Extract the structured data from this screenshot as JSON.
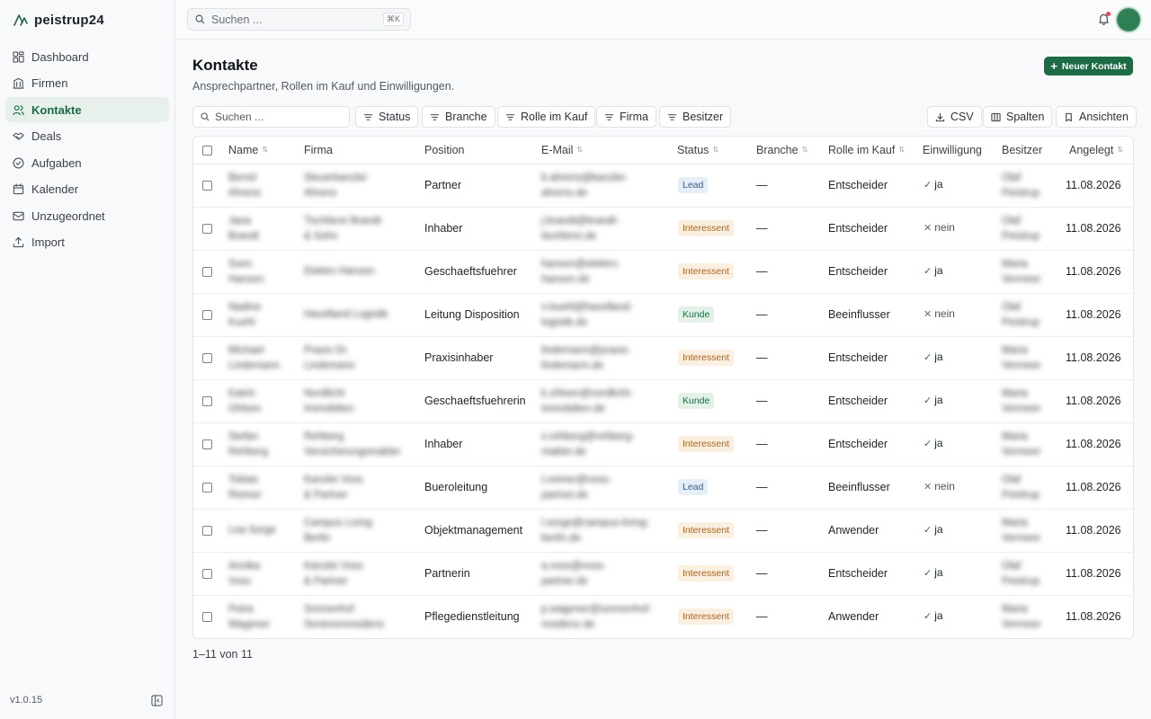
{
  "app": {
    "name": "peistrup24",
    "version": "v1.0.15"
  },
  "sidebar": {
    "items": [
      {
        "label": "Dashboard",
        "icon": "dashboard-icon",
        "active": false
      },
      {
        "label": "Firmen",
        "icon": "building-icon",
        "active": false
      },
      {
        "label": "Kontakte",
        "icon": "users-icon",
        "active": true
      },
      {
        "label": "Deals",
        "icon": "handshake-icon",
        "active": false
      },
      {
        "label": "Aufgaben",
        "icon": "check-circle-icon",
        "active": false
      },
      {
        "label": "Kalender",
        "icon": "calendar-icon",
        "active": false
      },
      {
        "label": "Unzugeordnet",
        "icon": "mail-icon",
        "active": false
      },
      {
        "label": "Import",
        "icon": "upload-icon",
        "active": false
      }
    ]
  },
  "topbar": {
    "search_placeholder": "Suchen ...",
    "shortcut": "⌘K"
  },
  "page": {
    "title": "Kontakte",
    "subtitle": "Ansprechpartner, Rollen im Kauf und Einwilligungen.",
    "new_button": "Neuer Kontakt"
  },
  "toolbar": {
    "search_placeholder": "Suchen ...",
    "filters": [
      "Status",
      "Branche",
      "Rolle im Kauf",
      "Firma",
      "Besitzer"
    ],
    "csv": "CSV",
    "columns": "Spalten",
    "views": "Ansichten"
  },
  "table": {
    "headers": {
      "name": "Name",
      "firma": "Firma",
      "position": "Position",
      "email": "E-Mail",
      "status": "Status",
      "branche": "Branche",
      "rolle": "Rolle im Kauf",
      "einwilligung": "Einwilligung",
      "besitzer": "Besitzer",
      "angelegt": "Angelegt"
    },
    "rows": [
      {
        "name": "Bernd Ahrens",
        "firma": "Steuerkanzlei Ahrens",
        "position": "Partner",
        "email": "b.ahrens@kanzlei-ahrens.de",
        "status": "Lead",
        "status_type": "lead",
        "branche": "—",
        "rolle": "Entscheider",
        "einwilligung": "ja",
        "consent": true,
        "besitzer": "Olaf Peistrup",
        "angelegt": "11.08.2026"
      },
      {
        "name": "Jana Brandt",
        "firma": "Tischlerei Brandt & Sohn",
        "position": "Inhaber",
        "email": "j.brandt@brandt-tischlerei.de",
        "status": "Interessent",
        "status_type": "interessent",
        "branche": "—",
        "rolle": "Entscheider",
        "einwilligung": "nein",
        "consent": false,
        "besitzer": "Olaf Peistrup",
        "angelegt": "11.08.2026"
      },
      {
        "name": "Sven Hansen",
        "firma": "Elektro Hansen",
        "position": "Geschaeftsfuehrer",
        "email": "hansen@elektro-hansen.de",
        "status": "Interessent",
        "status_type": "interessent",
        "branche": "—",
        "rolle": "Entscheider",
        "einwilligung": "ja",
        "consent": true,
        "besitzer": "Maria Vermeer",
        "angelegt": "11.08.2026"
      },
      {
        "name": "Nadine Kuehl",
        "firma": "Havelland Logistik",
        "position": "Leitung Disposition",
        "email": "n.kuehl@havelland-logistik.de",
        "status": "Kunde",
        "status_type": "kunde",
        "branche": "—",
        "rolle": "Beeinflusser",
        "einwilligung": "nein",
        "consent": false,
        "besitzer": "Olaf Peistrup",
        "angelegt": "11.08.2026"
      },
      {
        "name": "Michael Lindemann",
        "firma": "Praxis Dr. Lindemann",
        "position": "Praxisinhaber",
        "email": "lindemann@praxis-lindemann.de",
        "status": "Interessent",
        "status_type": "interessent",
        "branche": "—",
        "rolle": "Entscheider",
        "einwilligung": "ja",
        "consent": true,
        "besitzer": "Maria Vermeer",
        "angelegt": "11.08.2026"
      },
      {
        "name": "Katrin Ohlsen",
        "firma": "Nordlicht Immobilien",
        "position": "Geschaeftsfuehrerin",
        "email": "k.ohlsen@nordlicht-immobilien.de",
        "status": "Kunde",
        "status_type": "kunde",
        "branche": "—",
        "rolle": "Entscheider",
        "einwilligung": "ja",
        "consent": true,
        "besitzer": "Maria Vermeer",
        "angelegt": "11.08.2026"
      },
      {
        "name": "Stefan Rehberg",
        "firma": "Rehberg Versicherungsmakler",
        "position": "Inhaber",
        "email": "s.rehberg@rehberg-makler.de",
        "status": "Interessent",
        "status_type": "interessent",
        "branche": "—",
        "rolle": "Entscheider",
        "einwilligung": "ja",
        "consent": true,
        "besitzer": "Maria Vermeer",
        "angelegt": "11.08.2026"
      },
      {
        "name": "Tobias Reimer",
        "firma": "Kanzlei Voss & Partner",
        "position": "Bueroleitung",
        "email": "t.reimer@voss-partner.de",
        "status": "Lead",
        "status_type": "lead",
        "branche": "—",
        "rolle": "Beeinflusser",
        "einwilligung": "nein",
        "consent": false,
        "besitzer": "Olaf Peistrup",
        "angelegt": "11.08.2026"
      },
      {
        "name": "Lea Sorge",
        "firma": "Campus Living Berlin",
        "position": "Objektmanagement",
        "email": "l.sorge@campus-living-berlin.de",
        "status": "Interessent",
        "status_type": "interessent",
        "branche": "—",
        "rolle": "Anwender",
        "einwilligung": "ja",
        "consent": true,
        "besitzer": "Maria Vermeer",
        "angelegt": "11.08.2026"
      },
      {
        "name": "Annika Voss",
        "firma": "Kanzlei Voss & Partner",
        "position": "Partnerin",
        "email": "a.voss@voss-partner.de",
        "status": "Interessent",
        "status_type": "interessent",
        "branche": "—",
        "rolle": "Entscheider",
        "einwilligung": "ja",
        "consent": true,
        "besitzer": "Olaf Peistrup",
        "angelegt": "11.08.2026"
      },
      {
        "name": "Petra Wagener",
        "firma": "Sonnenhof Seniorenresidenz",
        "position": "Pflegedienstleitung",
        "email": "p.wagener@sonnenhof-residenz.de",
        "status": "Interessent",
        "status_type": "interessent",
        "branche": "—",
        "rolle": "Anwender",
        "einwilligung": "ja",
        "consent": true,
        "besitzer": "Maria Vermeer",
        "angelegt": "11.08.2026"
      }
    ]
  },
  "pagination": {
    "text": "1–11 von 11"
  },
  "colors": {
    "accent": "#1b6b44",
    "active_nav_bg": "#e7f0ea",
    "lead": "#2d5f9a",
    "interessent": "#b0641a",
    "kunde": "#1e6b44"
  }
}
